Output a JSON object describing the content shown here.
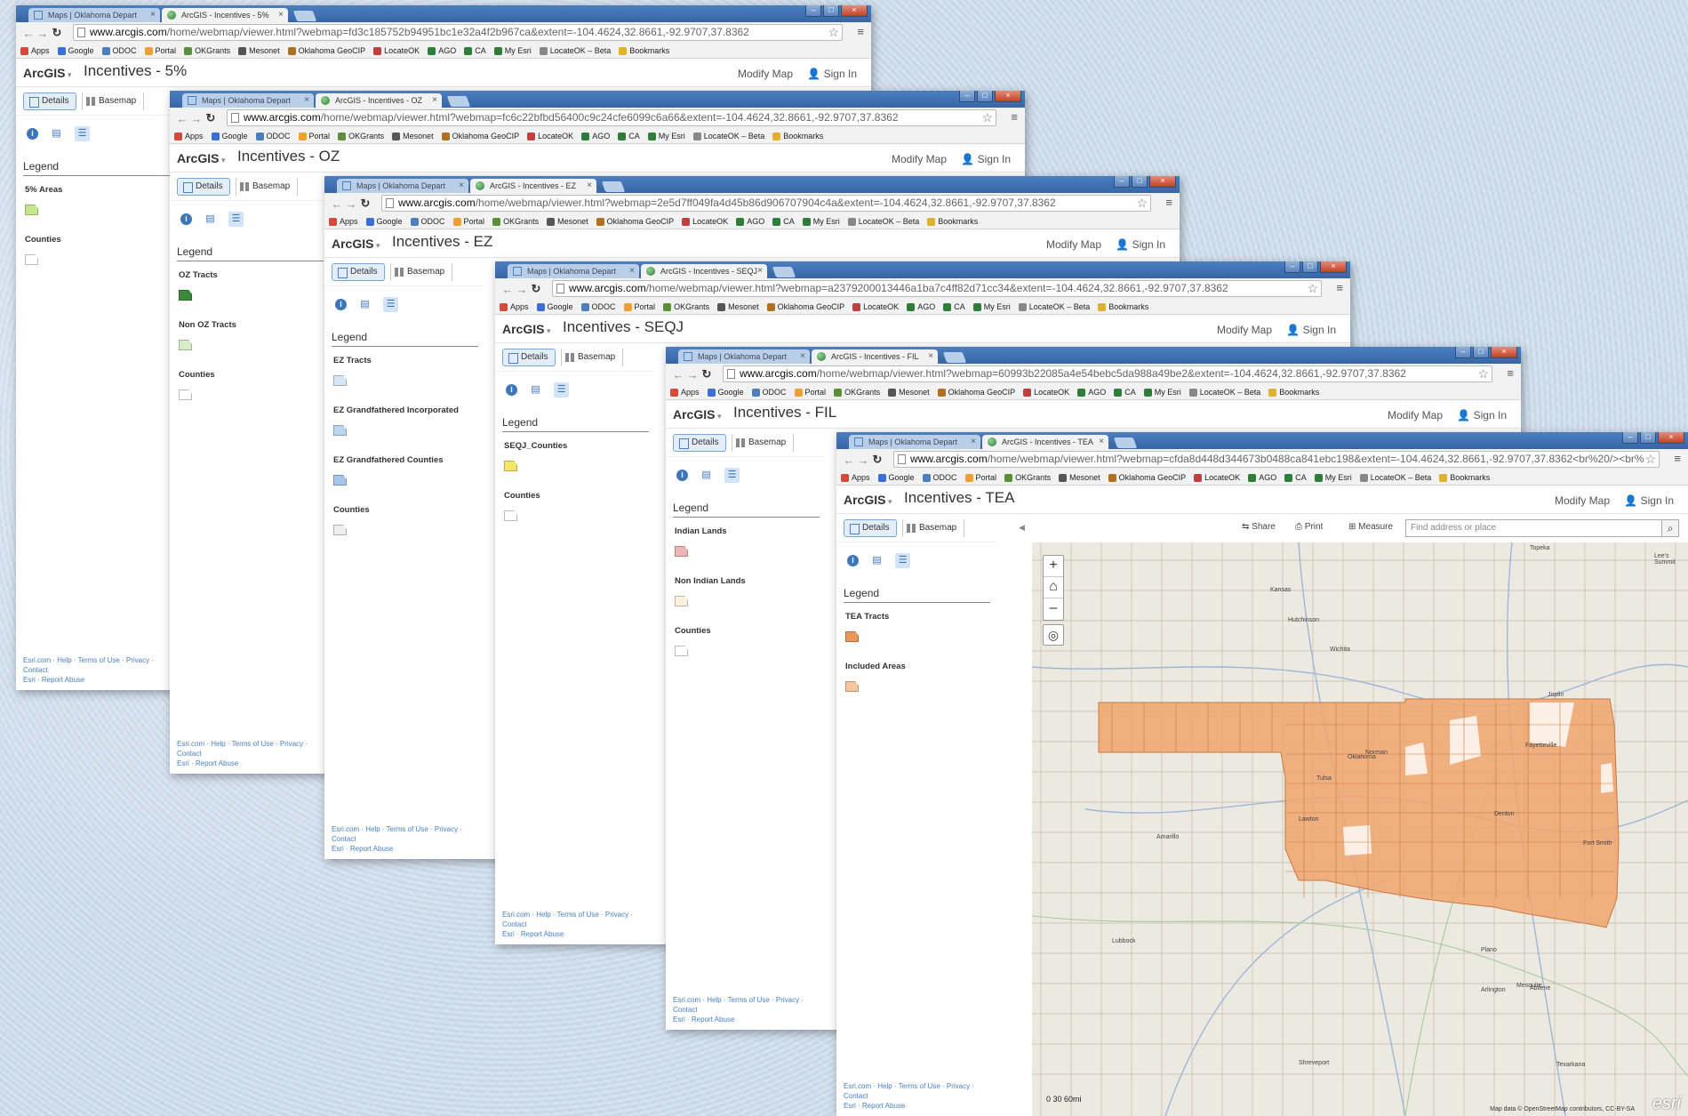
{
  "common": {
    "inactive_tab": "Maps | Oklahoma Depart",
    "url_domain": "www.arcgis.com",
    "brand": "ArcGIS",
    "modify_map": "Modify Map",
    "sign_in": "Sign In",
    "details": "Details",
    "basemap": "Basemap",
    "legend_heading": "Legend",
    "footer_line1": "Esri.com · Help · Terms of Use · Privacy · Contact",
    "footer_line2": "Esri · Report Abuse",
    "bookmarks": [
      "Apps",
      "Google",
      "ODOC",
      "Portal",
      "OKGrants",
      "Mesonet",
      "Oklahoma GeoCIP",
      "LocateOK",
      "AGO",
      "CA",
      "My Esri",
      "LocateOK – Beta",
      "Bookmarks"
    ],
    "bookmark_colors": [
      "#d14a3a",
      "#3b6fd8",
      "#4b7fc0",
      "#f0a030",
      "#5b8f3a",
      "#555",
      "#b07020",
      "#c04040",
      "#2f7d3a",
      "#2f7d3a",
      "#2f7d3a",
      "#888",
      "#e0b030"
    ]
  },
  "windows": [
    {
      "tab_active": "ArcGIS - Incentives - 5%",
      "url_path": "/home/webmap/viewer.html?webmap=fd3c185752b94951bc1e32a4f2b967ca&extent=-104.4624,32.8661,-92.9707,37.8362",
      "map_title": "Incentives - 5%",
      "legend": [
        {
          "label": "5% Areas",
          "color": "#c8e68c"
        },
        {
          "label": "Counties",
          "color": "#ffffff"
        }
      ]
    },
    {
      "tab_active": "ArcGIS - Incentives - OZ",
      "url_path": "/home/webmap/viewer.html?webmap=fc6c22bfbd56400c9c24cfe6099c6a66&extent=-104.4624,32.8661,-92.9707,37.8362",
      "map_title": "Incentives - OZ",
      "legend": [
        {
          "label": "OZ Tracts",
          "color": "#3a8a3a"
        },
        {
          "label": "Non OZ Tracts",
          "color": "#d6efc8"
        },
        {
          "label": "Counties",
          "color": "#ffffff"
        }
      ]
    },
    {
      "tab_active": "ArcGIS - Incentives - EZ",
      "url_path": "/home/webmap/viewer.html?webmap=2e5d7ff049fa4d45b86d906707904c4a&extent=-104.4624,32.8661,-92.9707,37.8362",
      "map_title": "Incentives - EZ",
      "legend": [
        {
          "label": "EZ Tracts",
          "color": "#d6e6f7"
        },
        {
          "label": "EZ Grandfathered Incorporated",
          "color": "#bcd6f0"
        },
        {
          "label": "EZ Grandfathered Counties",
          "color": "#a6c6e8"
        },
        {
          "label": "Counties",
          "color": "#eeeeee"
        }
      ]
    },
    {
      "tab_active": "ArcGIS - Incentives - SEQJ",
      "url_path": "/home/webmap/viewer.html?webmap=a2379200013446a1ba7c4ff82d71cc34&extent=-104.4624,32.8661,-92.9707,37.8362",
      "map_title": "Incentives - SEQJ",
      "legend": [
        {
          "label": "SEQJ_Counties",
          "color": "#f4e46a"
        },
        {
          "label": "Counties",
          "color": "#ffffff"
        }
      ]
    },
    {
      "tab_active": "ArcGIS - Incentives - FIL",
      "url_path": "/home/webmap/viewer.html?webmap=60993b22085a4e54bebc5da988a49be2&extent=-104.4624,32.8661,-92.9707,37.8362",
      "map_title": "Incentives - FIL",
      "legend": [
        {
          "label": "Indian Lands",
          "color": "#f0b4b4"
        },
        {
          "label": "Non Indian Lands",
          "color": "#fdf0dc"
        },
        {
          "label": "Counties",
          "color": "#ffffff"
        }
      ]
    },
    {
      "tab_active": "ArcGIS - Incentives - TEA",
      "url_path": "/home/webmap/viewer.html?webmap=cfda8d448d344673b0488ca841ebc198&extent=-104.4624,32.8661,-92.9707,37.8362<br%20/><br%",
      "map_title": "Incentives - TEA",
      "legend": [
        {
          "label": "TEA Tracts",
          "color": "#e8965a"
        },
        {
          "label": "Included Areas",
          "color": "#f6c6a0"
        }
      ],
      "share": "Share",
      "print": "Print",
      "measure": "Measure",
      "find_placeholder": "Find address or place",
      "scale_label": "0     30     60mi",
      "attribution": "Map data © OpenStreetMap contributors, CC-BY-SA",
      "esri_logo": "esri",
      "map_places": [
        "Topeka",
        "Kansas",
        "Hutchinson",
        "Wichita",
        "Joplin",
        "Fayetteville",
        "Amarillo",
        "Oklahoma",
        "Tulsa",
        "Norman",
        "Lawton",
        "Lubbock",
        "Denton",
        "Plano",
        "Arlington",
        "Mesquite",
        "Abilene",
        "Texarkana",
        "Shreveport",
        "Lee's Summit",
        "Fort Smith"
      ]
    }
  ]
}
